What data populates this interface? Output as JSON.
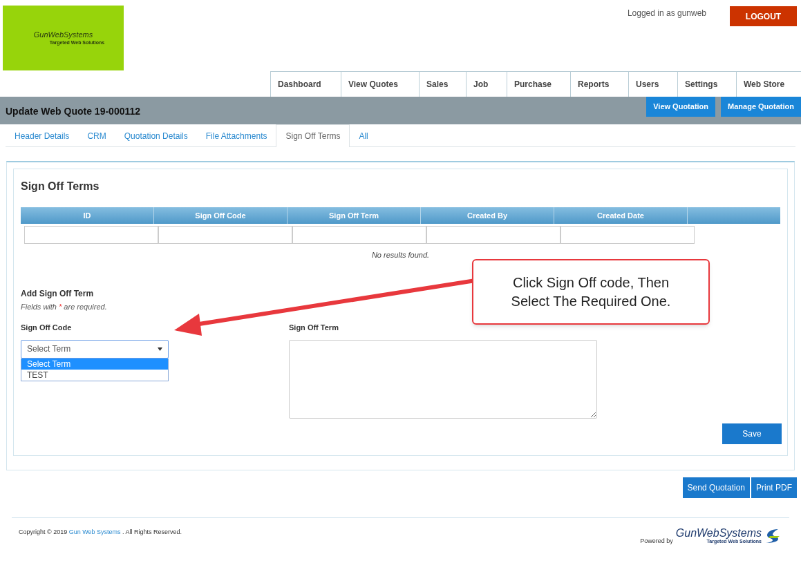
{
  "logo": {
    "name": "GunWebSystems",
    "tagline": "Targeted Web Solutions"
  },
  "user": {
    "logged_in_text": "Logged in as gunweb",
    "logout": "LOGOUT"
  },
  "nav": [
    {
      "label": "Dashboard"
    },
    {
      "label": "View Quotes"
    },
    {
      "label": "Sales"
    },
    {
      "label": "Job"
    },
    {
      "label": "Purchase"
    },
    {
      "label": "Reports"
    },
    {
      "label": "Users"
    },
    {
      "label": "Settings"
    },
    {
      "label": "Web Store"
    }
  ],
  "title_bar": {
    "title": "Update Web Quote 19-000112",
    "buttons": [
      "View Quotation",
      "Manage Quotation"
    ]
  },
  "tabs": [
    {
      "label": "Header Details",
      "selected": false
    },
    {
      "label": "CRM",
      "selected": false
    },
    {
      "label": "Quotation Details",
      "selected": false
    },
    {
      "label": "File Attachments",
      "selected": false
    },
    {
      "label": "Sign Off Terms",
      "selected": true
    },
    {
      "label": "All",
      "selected": false
    }
  ],
  "panel": {
    "title": "Sign Off Terms",
    "table": {
      "columns": [
        "ID",
        "Sign Off Code",
        "Sign Off Term",
        "Created By",
        "Created Date"
      ],
      "empty_text": "No results found."
    },
    "form": {
      "title": "Add Sign Off Term",
      "note_before": "Fields with",
      "required_mark": "*",
      "note_after": "are required.",
      "code_label": "Sign Off Code",
      "code_value": "Select Term",
      "options": [
        {
          "label": "Select Term",
          "selected": true
        },
        {
          "label": "TEST",
          "selected": false
        }
      ],
      "term_label": "Sign Off Term",
      "save": "Save"
    }
  },
  "callout": {
    "text": "Click Sign Off code, Then Select The Required One."
  },
  "actions": [
    "Send Quotation",
    "Print PDF"
  ],
  "footer": {
    "copyright_before": "Copyright © 2019",
    "company_link": "Gun Web Systems",
    "copyright_after": ". All Rights Reserved.",
    "powered_by": "Powered by",
    "brand": "GunWebSystems",
    "brand_tagline": "Targeted Web Solutions"
  }
}
